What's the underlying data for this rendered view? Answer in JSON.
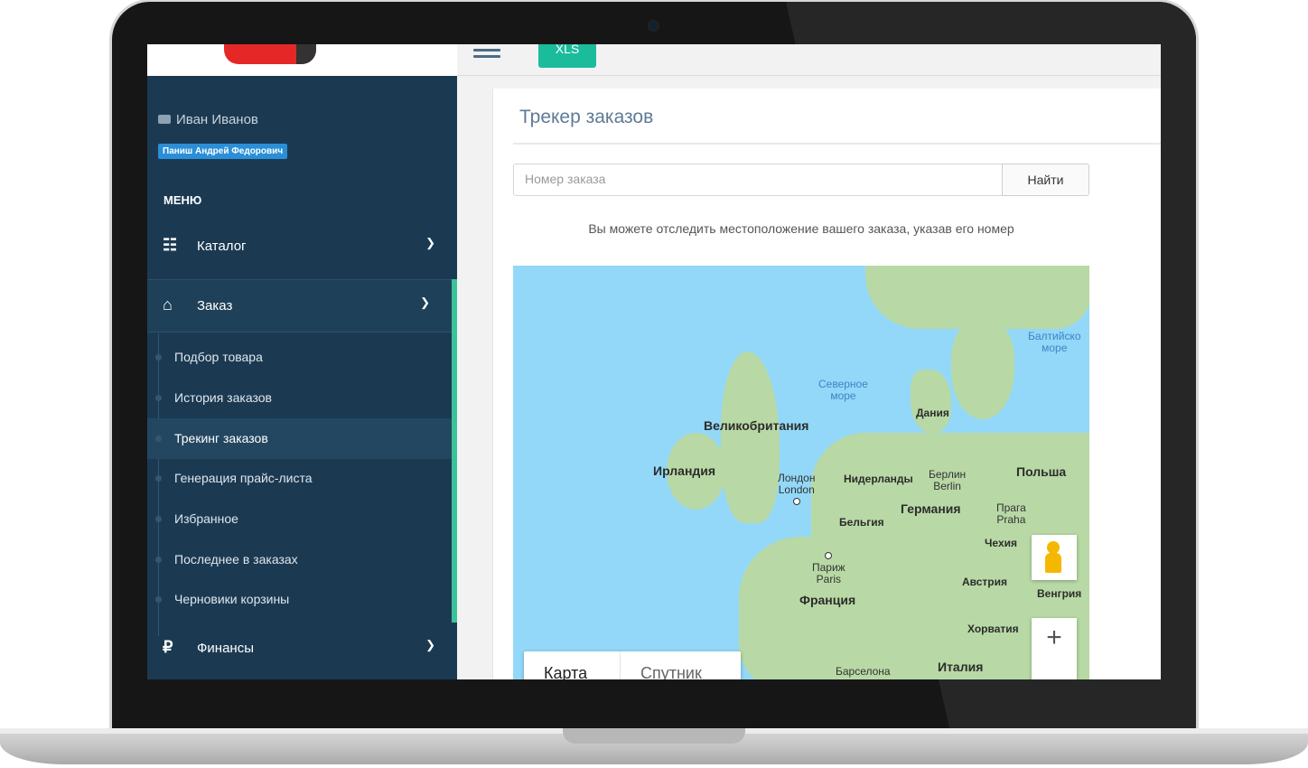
{
  "sidebar": {
    "user_name": "Иван Иванов",
    "manager_badge": "Паниш Андрей Федорович",
    "menu_heading": "МЕНЮ",
    "items": [
      {
        "label": "Каталог",
        "icon": "sitemap-icon"
      },
      {
        "label": "Заказ",
        "icon": "home-icon"
      },
      {
        "label": "Финансы",
        "icon": "ruble-icon"
      }
    ],
    "sub_items": [
      "Подбор товара",
      "История заказов",
      "Трекинг заказов",
      "Генерация прайс-листа",
      "Избранное",
      "Последнее в заказах",
      "Черновики корзины"
    ],
    "active_sub_item": "Трекинг заказов",
    "accent_color": "#3cc29a",
    "bg_color": "#1b3a52"
  },
  "topbar": {
    "xls_label": "XLS"
  },
  "main": {
    "title": "Трекер заказов",
    "search_placeholder": "Номер заказа",
    "search_value": "",
    "find_button": "Найти",
    "hint": "Вы можете отследить местоположение вашего заказа, указав его номер"
  },
  "map": {
    "countries": {
      "uk": "Великобритания",
      "ireland": "Ирландия",
      "denmark": "Дания",
      "netherlands": "Нидерланды",
      "germany": "Германия",
      "poland": "Польша",
      "belgium": "Бельгия",
      "czech": "Чехия",
      "france": "Франция",
      "austria": "Австрия",
      "hungary": "Венгрия",
      "croatia": "Хорватия",
      "italy": "Италия"
    },
    "cities": {
      "london_ru": "Лондон",
      "london_en": "London",
      "berlin_ru": "Берлин",
      "berlin_en": "Berlin",
      "prague_ru": "Прага",
      "prague_en": "Praha",
      "paris_ru": "Париж",
      "paris_en": "Paris",
      "barcelona": "Барселона"
    },
    "seas": {
      "north_sea_1": "Северное",
      "north_sea_2": "море",
      "baltic_1": "Балтийско",
      "baltic_2": "море"
    },
    "type_map": "Карта",
    "type_satellite": "Спутник",
    "zoom_in": "+",
    "pegman_icon": "pegman-icon"
  }
}
